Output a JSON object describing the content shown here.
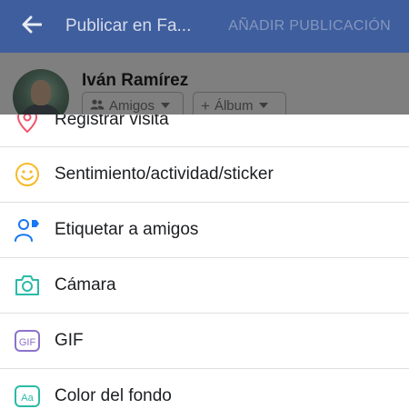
{
  "appbar": {
    "title": "Publicar en Fa...",
    "action_label": "AÑADIR PUBLICACIÓN",
    "back_icon": "back-arrow-icon",
    "background": "#3f5e9e"
  },
  "composer": {
    "user_name": "Iván Ramírez",
    "audience_label": "Amigos",
    "album_label": "Álbum"
  },
  "menu": {
    "items": [
      {
        "label": "Registrar visita",
        "icon": "location-pin-icon",
        "color": "#f35369"
      },
      {
        "label": "Sentimiento/actividad/sticker",
        "icon": "smiley-icon",
        "color": "#f7b928"
      },
      {
        "label": "Etiquetar a amigos",
        "icon": "tag-friends-icon",
        "color": "#1877f2"
      },
      {
        "label": "Cámara",
        "icon": "camera-icon",
        "color": "#2abba7"
      },
      {
        "label": "GIF",
        "icon": "gif-icon",
        "color": "#8c72cb"
      },
      {
        "label": "Color del fondo",
        "icon": "text-background-icon",
        "color": "#2abba7"
      }
    ]
  }
}
